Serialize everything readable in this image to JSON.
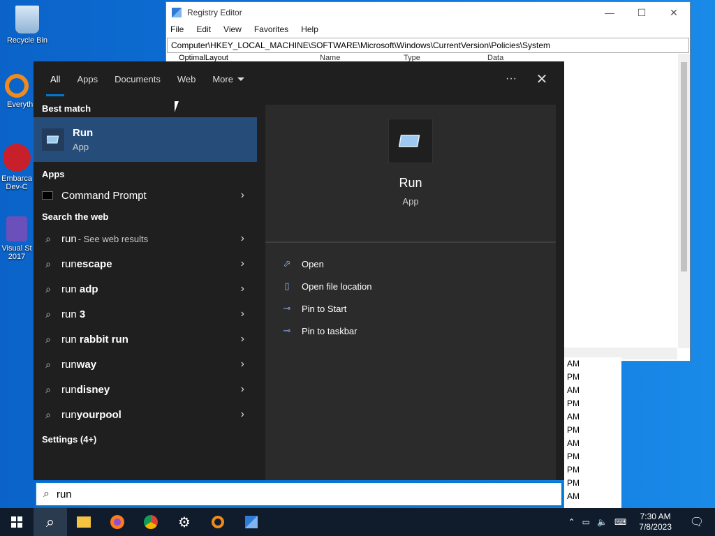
{
  "desktop": {
    "icons": [
      {
        "label": "Recycle Bin",
        "icon": "recycle-bin-icon"
      },
      {
        "label": "Everyth",
        "icon": "everything-search-icon"
      },
      {
        "label": "Embarca Dev-C",
        "icon": "dev-cpp-icon"
      },
      {
        "label": "Visual St 2017",
        "icon": "visual-studio-icon"
      }
    ]
  },
  "registry": {
    "title": "Registry Editor",
    "menu": [
      "File",
      "Edit",
      "View",
      "Favorites",
      "Help"
    ],
    "address": "Computer\\HKEY_LOCAL_MACHINE\\SOFTWARE\\Microsoft\\Windows\\CurrentVersion\\Policies\\System",
    "tree_item": "OptimalLayout",
    "columns": [
      "Name",
      "Type",
      "Data"
    ]
  },
  "background_times": [
    "AM",
    "PM",
    "AM",
    "PM",
    "AM",
    "PM",
    "AM",
    "PM",
    "PM",
    "PM",
    "AM"
  ],
  "search": {
    "tabs": [
      "All",
      "Apps",
      "Documents",
      "Web",
      "More"
    ],
    "more_icon": "ellipsis-icon",
    "close_icon": "close-icon",
    "best_match_header": "Best match",
    "best_match": {
      "name": "Run",
      "type": "App"
    },
    "apps_header": "Apps",
    "apps": [
      {
        "name": "Command Prompt"
      }
    ],
    "web_header": "Search the web",
    "web_first": {
      "query": "run",
      "suffix": " - See web results"
    },
    "web_results": [
      {
        "prefix": "run",
        "bold": "escape"
      },
      {
        "prefix": "run ",
        "bold": "adp"
      },
      {
        "prefix": "run ",
        "bold": "3"
      },
      {
        "prefix": "run ",
        "bold": "rabbit run"
      },
      {
        "prefix": "run",
        "bold": "way"
      },
      {
        "prefix": "run",
        "bold": "disney"
      },
      {
        "prefix": "run",
        "bold": "yourpool"
      }
    ],
    "settings_header": "Settings (4+)",
    "preview": {
      "name": "Run",
      "type": "App"
    },
    "actions": [
      {
        "label": "Open",
        "icon": "open-icon"
      },
      {
        "label": "Open file location",
        "icon": "file-location-icon"
      },
      {
        "label": "Pin to Start",
        "icon": "pin-icon"
      },
      {
        "label": "Pin to taskbar",
        "icon": "pin-icon"
      }
    ],
    "query": "run"
  },
  "taskbar": {
    "time": "7:30 AM",
    "date": "7/8/2023"
  }
}
